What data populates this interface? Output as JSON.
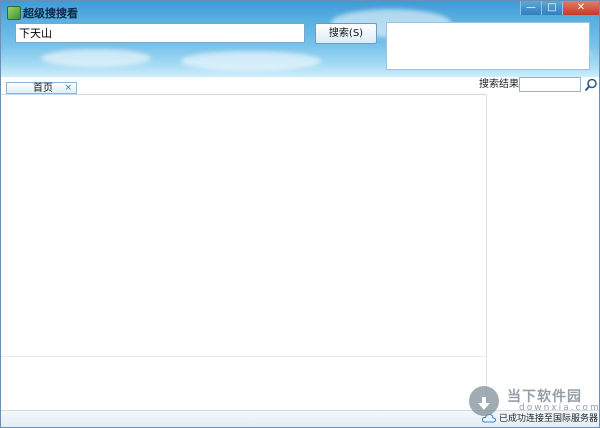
{
  "window": {
    "title": "超级搜搜看",
    "controls": {
      "minimize": "—",
      "maximize": "□",
      "close": "✕"
    }
  },
  "search": {
    "query": "下天山",
    "button_label": "搜索(S)"
  },
  "tabs": [
    {
      "label": "首页",
      "close": "×"
    }
  ],
  "results_panel": {
    "label": "搜索结果",
    "filter_value": ""
  },
  "status": {
    "text": "已成功连接至国际服务器"
  },
  "watermark": {
    "name": "当下软件园",
    "url": "downxia.com"
  },
  "colors": {
    "header_top": "#3f9bd6",
    "header_bottom": "#cfeefb",
    "border": "#6a8fb3"
  },
  "icons": {
    "app": "app-icon",
    "search": "magnifier-icon",
    "status": "cloud-icon"
  }
}
